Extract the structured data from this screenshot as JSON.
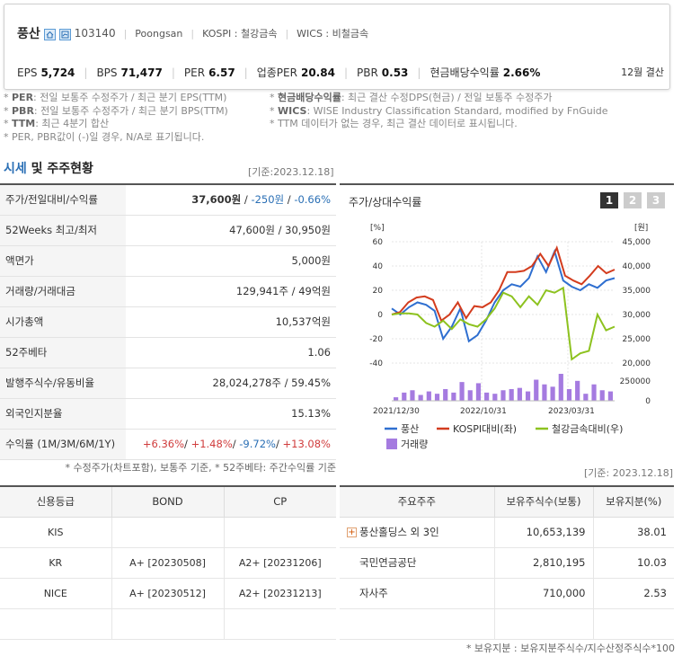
{
  "header": {
    "company": "풍산",
    "code": "103140",
    "english_name": "Poongsan",
    "kospi": "KOSPI : 철강금속",
    "wics": "WICS : 비철금속",
    "fiscal": "12월 결산",
    "metrics": [
      {
        "label": "EPS",
        "value": "5,724"
      },
      {
        "label": "BPS",
        "value": "71,477"
      },
      {
        "label": "PER",
        "value": "6.57"
      },
      {
        "label": "업종PER",
        "value": "20.84"
      },
      {
        "label": "PBR",
        "value": "0.53"
      },
      {
        "label": "현금배당수익률",
        "value": "2.66%"
      }
    ]
  },
  "notes_left": [
    {
      "key": "PER",
      "text": ": 전일 보통주 수정주가 / 최근 분기 EPS(TTM)"
    },
    {
      "key": "PBR",
      "text": ": 전일 보통주 수정주가 / 최근 분기 BPS(TTM)"
    },
    {
      "key": "TTM",
      "text": ": 최근 4분기 합산"
    },
    {
      "key": "",
      "text": "PER, PBR값이 (-)일 경우, N/A로 표기됩니다."
    }
  ],
  "notes_right": [
    {
      "key": "현금배당수익률",
      "text": ": 최근 결산 수정DPS(현금) / 전일 보통주 수정주가"
    },
    {
      "key": "WICS",
      "text": ": WISE Industry Classification Standard, modified by FnGuide"
    },
    {
      "key": "",
      "text": "TTM 데이터가 없는 경우, 최근 결산 데이터로 표시됩니다."
    }
  ],
  "section": {
    "title_a": "시세",
    "title_b": " 및 주주현황",
    "basis": "[기준:2023.12.18]"
  },
  "quote_rows": [
    {
      "label": "주가/전일대비/수익률",
      "v1": "37,600원",
      "v2": "-250원",
      "v3": "-0.66%"
    },
    {
      "label": "52Weeks 최고/최저",
      "value": "47,600원 / 30,950원"
    },
    {
      "label": "액면가",
      "value": "5,000원"
    },
    {
      "label": "거래량/거래대금",
      "value": "129,941주 / 49억원"
    },
    {
      "label": "시가총액",
      "value": "10,537억원"
    },
    {
      "label": "52주베타",
      "value": "1.06"
    },
    {
      "label": "발행주식수/유동비율",
      "value": "28,024,278주 / 59.45%"
    },
    {
      "label": "외국인지분율",
      "value": "15.13%"
    },
    {
      "label": "수익률 (1M/3M/6M/1Y)",
      "r1": "+6.36%",
      "r2": "+1.48%",
      "r3": "-9.72%",
      "r4": "+13.08%"
    }
  ],
  "quote_footnote": "* 수정주가(차트포함), 보통주 기준, * 52주베타: 주간수익률 기준",
  "chart_panel": {
    "title": "주가/상대수익률",
    "tabs": [
      "1",
      "2",
      "3"
    ]
  },
  "chart_data": {
    "type": "line",
    "left_unit": "[%]",
    "right_unit": "[원]",
    "left_ticks": [
      "60",
      "40",
      "20",
      "0",
      "-20",
      "-40"
    ],
    "right_ticks": [
      "45,000",
      "40,000",
      "35,000",
      "30,000",
      "25,000",
      "20,000"
    ],
    "volume_ticks": [
      "250000",
      "0"
    ],
    "x_labels": [
      "2021/12/30",
      "2022/10/31",
      "2023/03/31"
    ],
    "ylim_left": [
      -40,
      60
    ],
    "series": [
      {
        "name": "풍산",
        "color": "#2f6fd0",
        "values": [
          5,
          0,
          6,
          10,
          8,
          3,
          -20,
          -10,
          5,
          -22,
          -17,
          -5,
          10,
          20,
          25,
          23,
          30,
          48,
          35,
          52,
          28,
          23,
          20,
          25,
          22,
          28,
          30
        ]
      },
      {
        "name": "KOSPI대비(좌)",
        "color": "#d33c1e",
        "values": [
          0,
          2,
          10,
          14,
          15,
          12,
          -5,
          0,
          10,
          -3,
          7,
          6,
          10,
          20,
          35,
          35,
          36,
          40,
          50,
          40,
          55,
          32,
          28,
          25,
          32,
          40,
          34,
          37
        ]
      },
      {
        "name": "철강금속대비(우)",
        "color": "#8dc21f",
        "values": [
          0,
          1,
          1,
          0,
          -7,
          -10,
          -5,
          -12,
          -4,
          -8,
          -10,
          -4,
          5,
          18,
          15,
          6,
          15,
          8,
          20,
          18,
          22,
          -37,
          -32,
          -30,
          0,
          -13,
          -10
        ]
      }
    ],
    "volume": {
      "name": "거래량",
      "color": "#a57be0",
      "values": [
        30,
        70,
        90,
        50,
        80,
        60,
        100,
        70,
        160,
        90,
        150,
        70,
        60,
        90,
        100,
        110,
        80,
        180,
        140,
        120,
        230,
        100,
        170,
        60,
        140,
        90,
        80
      ]
    }
  },
  "credit": {
    "headers": [
      "신용등급",
      "BOND",
      "CP"
    ],
    "rows": [
      [
        "KIS",
        "",
        ""
      ],
      [
        "KR",
        "A+ [20230508]",
        "A2+ [20231206]"
      ],
      [
        "NICE",
        "A+ [20230512]",
        "A2+ [20231213]"
      ],
      [
        "",
        "",
        ""
      ]
    ]
  },
  "holders": {
    "basis": "[기준: 2023.12.18]",
    "headers": [
      "주요주주",
      "보유주식수(보통)",
      "보유지분(%)"
    ],
    "rows": [
      {
        "name": "풍산홀딩스 외 3인",
        "shares": "10,653,139",
        "pct": "38.01",
        "expand": "+"
      },
      {
        "name": "국민연금공단",
        "shares": "2,810,195",
        "pct": "10.03",
        "expand": ""
      },
      {
        "name": "자사주",
        "shares": "710,000",
        "pct": "2.53",
        "expand": ""
      }
    ],
    "footnote": "* 보유지분 : 보유지분주식수/지수산정주식수*100"
  }
}
